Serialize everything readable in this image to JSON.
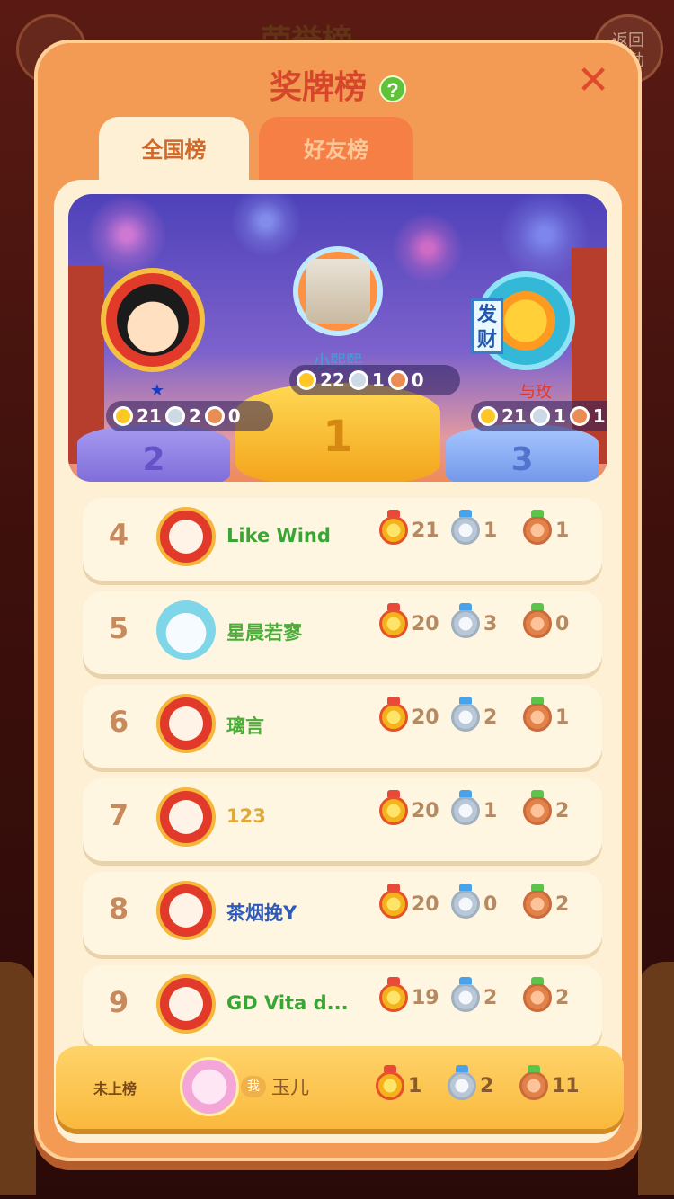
{
  "background": {
    "title": "荣誉榜",
    "back_label": "返回\n活动"
  },
  "modal": {
    "title": "奖牌榜",
    "help_icon": "question-icon",
    "close_icon": "close-icon"
  },
  "tabs": [
    {
      "label": "全国榜",
      "active": true
    },
    {
      "label": "好友榜",
      "active": false
    }
  ],
  "podium": {
    "first": {
      "rank": "1",
      "name": "小熙熙",
      "gold": "22",
      "silver": "1",
      "bronze": "0"
    },
    "second": {
      "rank": "2",
      "name": "★",
      "gold": "21",
      "silver": "2",
      "bronze": "0"
    },
    "third": {
      "rank": "3",
      "name": "与玫",
      "gold": "21",
      "silver": "1",
      "bronze": "1",
      "tag": "发财"
    }
  },
  "rows": [
    {
      "rank": "4",
      "name": "Like Wind",
      "gold": "21",
      "silver": "1",
      "bronze": "1",
      "name_color": "#3aa534"
    },
    {
      "rank": "5",
      "name": "星晨若寥",
      "gold": "20",
      "silver": "3",
      "bronze": "0",
      "name_color": "#4cae3a"
    },
    {
      "rank": "6",
      "name": "璃言",
      "gold": "20",
      "silver": "2",
      "bronze": "1",
      "name_color": "#4cae3a"
    },
    {
      "rank": "7",
      "name": "123",
      "gold": "20",
      "silver": "1",
      "bronze": "2",
      "name_color": "#e0a93a"
    },
    {
      "rank": "8",
      "name": "茶烟挽Y",
      "gold": "20",
      "silver": "0",
      "bronze": "2",
      "name_color": "#2f5bb8"
    },
    {
      "rank": "9",
      "name": "GD Vita d...",
      "gold": "19",
      "silver": "2",
      "bronze": "2",
      "name_color": "#3aa534"
    }
  ],
  "self": {
    "label": "未上榜",
    "me_badge": "我",
    "name": "玉儿",
    "gold": "1",
    "silver": "2",
    "bronze": "11"
  },
  "colors": {
    "modal_bg": "#f39a54",
    "panel_bg": "#fdf0d4",
    "title": "#d6462a",
    "row_bg": "#fff6e2",
    "self_bar": "#ffd36a"
  }
}
